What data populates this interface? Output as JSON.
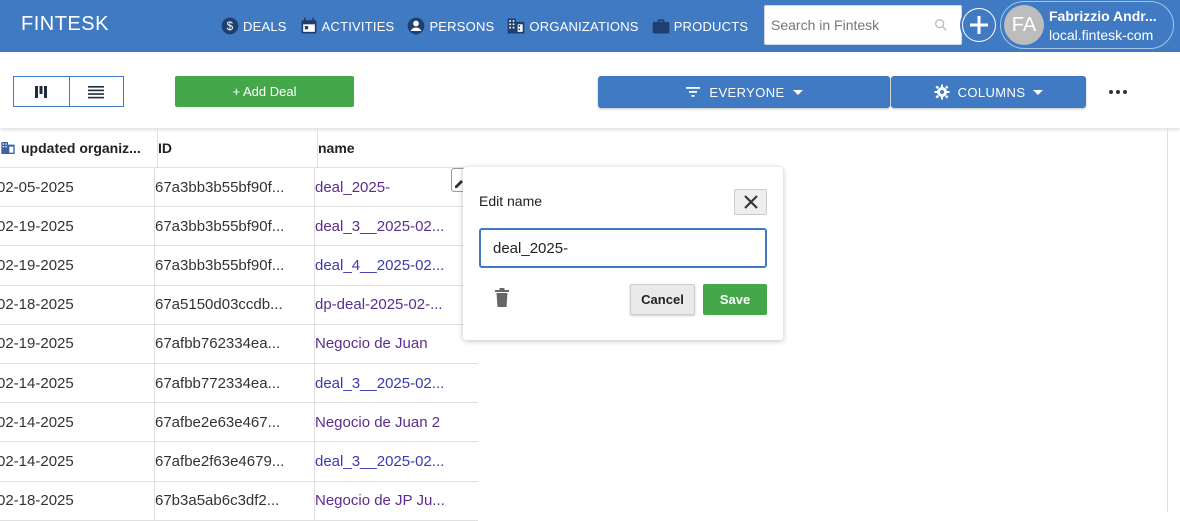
{
  "app": {
    "brand": "FINTESK"
  },
  "nav": [
    {
      "label": "DEALS",
      "icon": "dollar-circle-icon"
    },
    {
      "label": "ACTIVITIES",
      "icon": "calendar-icon"
    },
    {
      "label": "PERSONS",
      "icon": "person-circle-icon"
    },
    {
      "label": "ORGANIZATIONS",
      "icon": "building-icon"
    },
    {
      "label": "PRODUCTS",
      "icon": "briefcase-icon"
    }
  ],
  "search": {
    "placeholder": "Search in Fintesk"
  },
  "user": {
    "initials": "FA",
    "name": "Fabrizzio Andr...",
    "org": "local.fintesk-com"
  },
  "toolbar": {
    "add_deal_label": "+ Add Deal",
    "filter_label": "EVERYONE",
    "columns_label": "COLUMNS"
  },
  "table": {
    "headers": [
      "updated organiz...",
      "ID",
      "name"
    ],
    "rows": [
      {
        "date": "02-05-2025",
        "id": "67a3bb3b55bf90f...",
        "name": "deal_2025-",
        "color": "purple"
      },
      {
        "date": "02-19-2025",
        "id": "67a3bb3b55bf90f...",
        "name": "deal_3__2025-02...",
        "color": "purple"
      },
      {
        "date": "02-19-2025",
        "id": "67a3bb3b55bf90f...",
        "name": "deal_4__2025-02...",
        "color": "blue"
      },
      {
        "date": "02-18-2025",
        "id": "67a5150d03ccdb...",
        "name": "dp-deal-2025-02-...",
        "color": "purple"
      },
      {
        "date": "02-19-2025",
        "id": "67afbb762334ea...",
        "name": "Negocio de Juan",
        "color": "purple"
      },
      {
        "date": "02-14-2025",
        "id": "67afbb772334ea...",
        "name": "deal_3__2025-02...",
        "color": "blue"
      },
      {
        "date": "02-14-2025",
        "id": "67afbe2e63e467...",
        "name": "Negocio de Juan 2",
        "color": "purple"
      },
      {
        "date": "02-14-2025",
        "id": "67afbe2f63e4679...",
        "name": "deal_3__2025-02...",
        "color": "blue"
      },
      {
        "date": "02-18-2025",
        "id": "67b3a5ab6c3df2...",
        "name": "Negocio de JP Ju...",
        "color": "purple"
      }
    ]
  },
  "popover": {
    "title": "Edit name",
    "value": "deal_2025-",
    "cancel_label": "Cancel",
    "save_label": "Save"
  },
  "colors": {
    "primary": "#3f7ac3",
    "success": "#44a84a",
    "link_purple": "#5b2d8e",
    "link_blue": "#3a3ab0"
  }
}
